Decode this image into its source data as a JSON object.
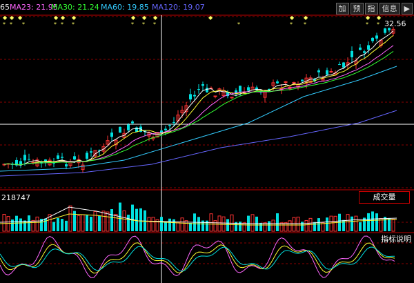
{
  "legend": {
    "items": [
      {
        "label": "65",
        "color": "#e6e6e6"
      },
      {
        "label": "MA23: 21.95",
        "color": "#ff66ff"
      },
      {
        "label": "MA30: 21.24",
        "color": "#33ff33"
      },
      {
        "label": "MA60: 19.85",
        "color": "#33ccff"
      },
      {
        "label": "MA120: 19.07",
        "color": "#6666ff"
      }
    ]
  },
  "toolbar": {
    "buttons": [
      "加",
      "预",
      "指",
      "信息",
      "▶"
    ]
  },
  "price_label": "32.56",
  "volume": {
    "value_label": "218747",
    "button_label": "成交量"
  },
  "indicator": {
    "button_label": "指标说明"
  },
  "chart_data": [
    {
      "type": "candlestick",
      "title": "",
      "series": [
        {
          "name": "MA23",
          "color": "#ff66ff"
        },
        {
          "name": "MA30",
          "color": "#33ff33"
        },
        {
          "name": "MA60",
          "color": "#33ccff"
        },
        {
          "name": "MA120",
          "color": "#6666ff"
        }
      ],
      "last_price": 32.56
    },
    {
      "type": "bar",
      "title": "成交量",
      "values": [
        218747
      ]
    }
  ]
}
